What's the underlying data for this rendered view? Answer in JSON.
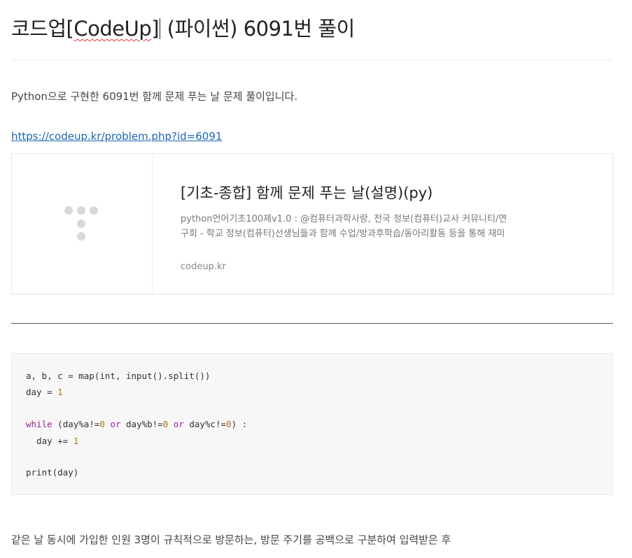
{
  "post": {
    "title_prefix": "코드업",
    "title_bracket_open": "[",
    "title_spell_word": "CodeUp",
    "title_bracket_close": "]",
    "title_rest": " (파이썬) 6091번 풀이",
    "intro": "Python으로 구현한 6091번 함께 문제 푸는 날 문제 풀이입니다.",
    "link_text": "https://codeup.kr/problem.php?id=6091",
    "final_text": "같은 날 동시에 가입한 인원 3명이 규칙적으로 방문하는, 방문 주기를 공백으로 구분하여 입력받은 후"
  },
  "og_card": {
    "title": "[기초-종합] 함께 문제 푸는 날(설명)(py)",
    "description": "python언어기초100제v1.0 : @컴퓨터과학사랑, 전국 정보(컴퓨터)교사 커뮤니티/연구회 - 학교 정보(컴퓨터)선생님들과 함께 수업/방과후학습/동아리활동 등을 통해 재미있게 배워보세요.",
    "host": "codeup.kr",
    "thumbnail_icon": "placeholder-dots-icon"
  },
  "code": {
    "line1": "a, b, c = map(int, input().split())",
    "line2_a": "day = ",
    "line2_num": "1",
    "line3_kw": "while",
    "line3_a": " (day%a!=",
    "line3_n1": "0",
    "line3_or1": "or",
    "line3_b": " day%b!=",
    "line3_n2": "0",
    "line3_or2": "or",
    "line3_c": " day%c!=",
    "line3_n3": "0",
    "line3_end": ") :",
    "line4_a": "  day += ",
    "line4_num": "1",
    "line5": "print(day)"
  },
  "colors": {
    "link": "#1a66b3",
    "keyword": "#9b2393",
    "number": "#b0700d",
    "code_bg": "#f7f7f7"
  }
}
